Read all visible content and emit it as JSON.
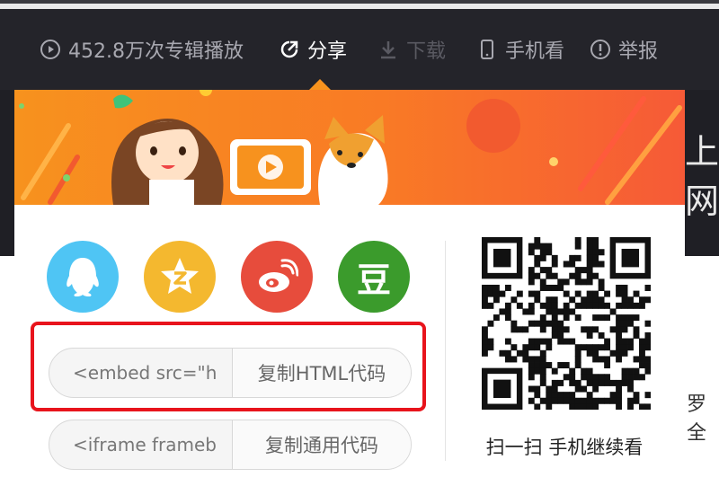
{
  "toolbar": {
    "plays": "452.8万次专辑播放",
    "share": "分享",
    "download": "下载",
    "mobile": "手机看",
    "report": "举报"
  },
  "background": {
    "right_title_fragment": "上网",
    "right_text_fragment": "罗全"
  },
  "share_panel": {
    "socials": [
      {
        "name": "QQ",
        "icon": "qq-penguin-icon",
        "color": "#4fc5f4"
      },
      {
        "name": "QQ空间",
        "icon": "qzone-star-icon",
        "color": "#f4b82f"
      },
      {
        "name": "微博",
        "icon": "weibo-icon",
        "color": "#e74c3c"
      },
      {
        "name": "豆瓣",
        "icon": "douban-icon",
        "glyph": "豆",
        "color": "#3b9b2c"
      }
    ],
    "embed": {
      "html_value": "<embed src=\"h",
      "html_button": "复制HTML代码",
      "iframe_value": "<iframe frameb",
      "iframe_button": "复制通用代码"
    },
    "qr_caption": "扫一扫 手机继续看"
  },
  "colors": {
    "accent_orange": "#f7931e",
    "highlight_red": "#e8141c",
    "toolbar_bg": "#24242a"
  }
}
